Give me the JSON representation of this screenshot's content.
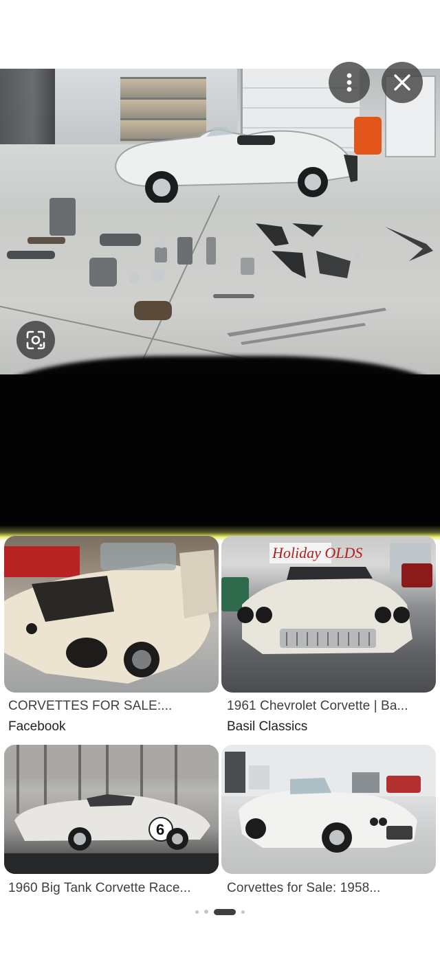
{
  "viewer": {
    "main_image_alt": "Disassembled Corvette with parts laid out on garage floor",
    "actions": {
      "more_icon": "more-vertical-icon",
      "close_icon": "close-icon",
      "lens_icon": "google-lens-icon"
    }
  },
  "results": [
    {
      "title": "CORVETTES FOR SALE:...",
      "source": "Facebook"
    },
    {
      "title": "1961 Chevrolet Corvette | Ba...",
      "source": "Basil Classics",
      "sign_text": "Holiday OLDS"
    },
    {
      "title": "1960 Big Tank Corvette Race...",
      "source": "",
      "race_number": "6"
    },
    {
      "title": "Corvettes for Sale: 1958...",
      "source": ""
    }
  ],
  "pagination": {
    "total": 4,
    "active_index": 2
  },
  "colors": {
    "overlay_button": "#3c3c3c",
    "title_text": "#3c4043",
    "source_text": "#202124",
    "active_dot": "#3c4043",
    "inactive_dot": "#c4c7c5"
  }
}
